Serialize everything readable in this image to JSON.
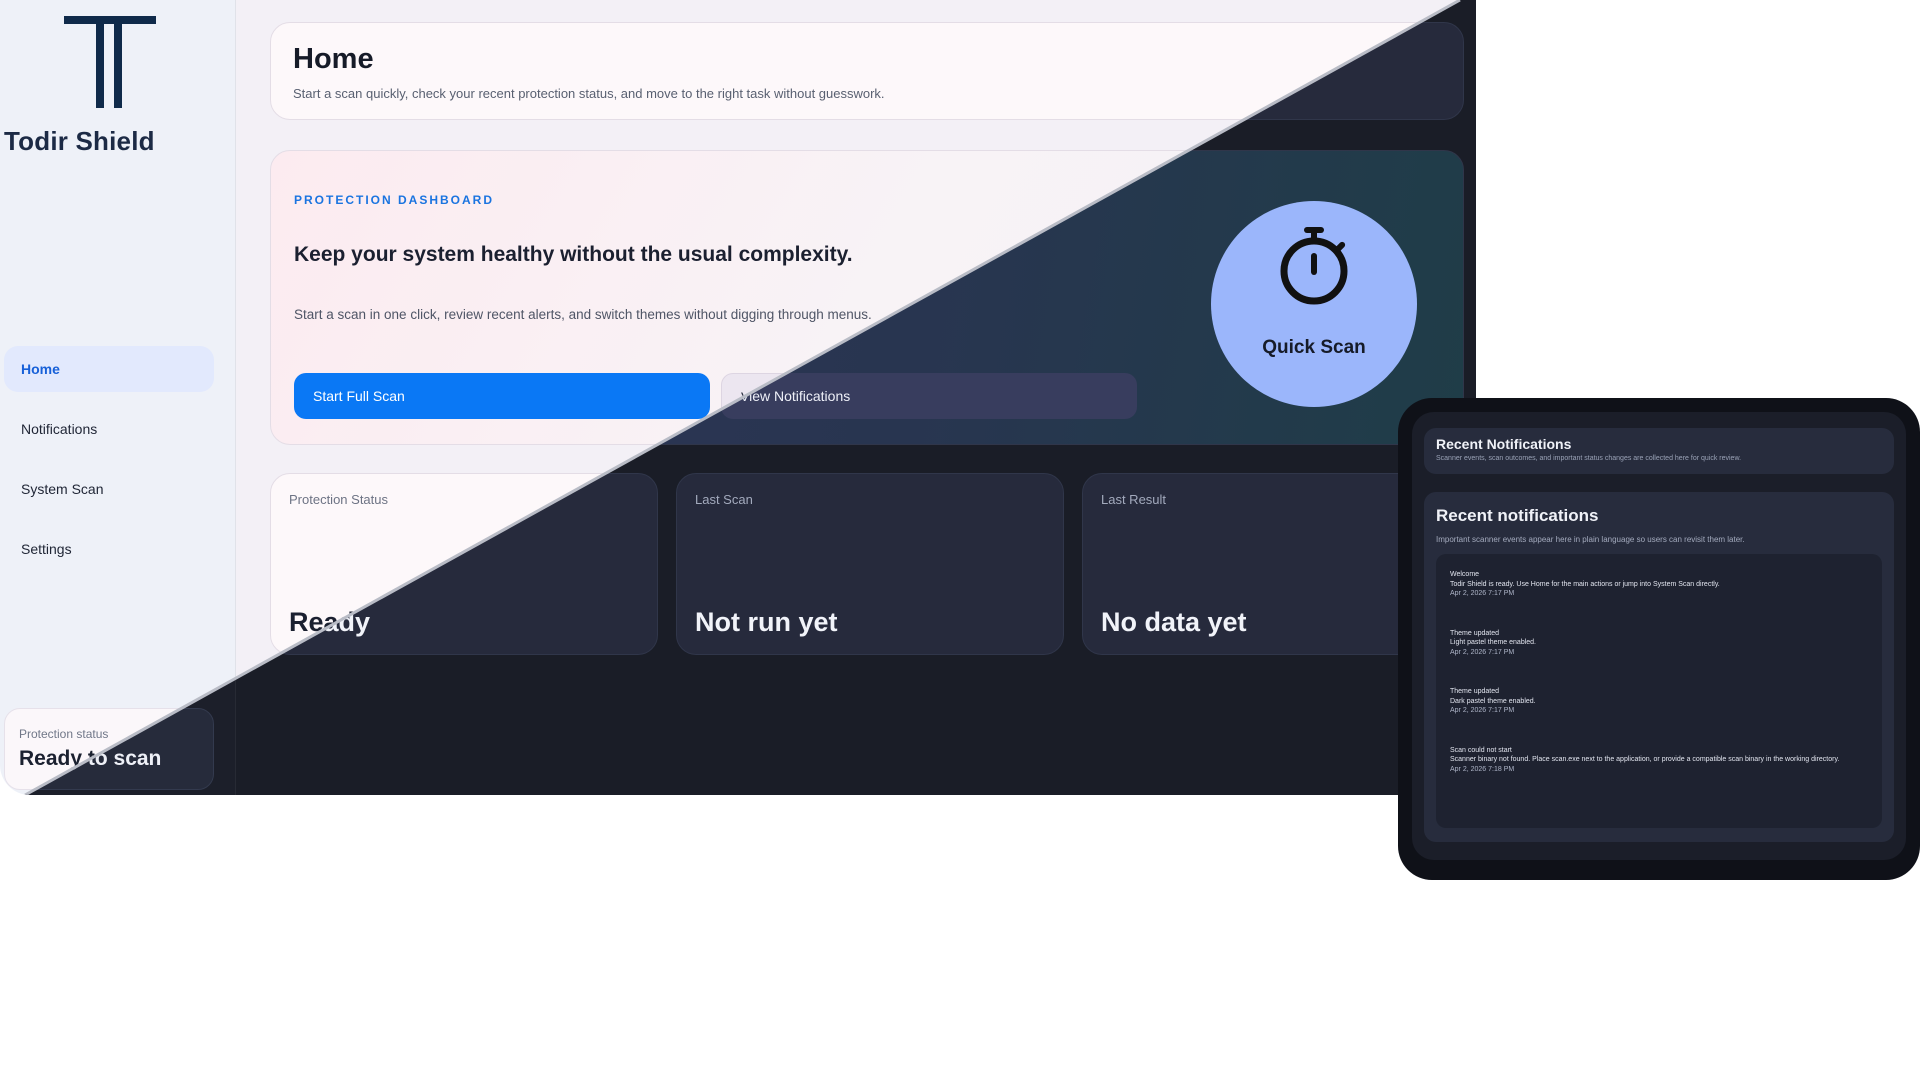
{
  "brand": {
    "name": "Todir Shield",
    "logo_icon": "tower-t-logo-icon"
  },
  "nav": {
    "items": [
      {
        "label": "Home",
        "active": true
      },
      {
        "label": "Notifications",
        "active": false
      },
      {
        "label": "System Scan",
        "active": false
      },
      {
        "label": "Settings",
        "active": false
      }
    ]
  },
  "side_status": {
    "label": "Protection status",
    "value": "Ready to scan"
  },
  "header": {
    "title": "Home",
    "subtitle": "Start a scan quickly, check your recent protection status, and move to the right task without guesswork."
  },
  "hero": {
    "eyebrow": "PROTECTION DASHBOARD",
    "title": "Keep your system healthy without the usual complexity.",
    "text": "Start a scan in one click, review recent alerts, and switch themes without digging through menus.",
    "primary_label": "Start Full Scan",
    "secondary_label": "View Notifications",
    "quick_scan_label": "Quick Scan",
    "quick_scan_icon": "stopwatch-icon"
  },
  "stats": [
    {
      "label": "Protection Status",
      "value": "Ready"
    },
    {
      "label": "Last Scan",
      "value": "Not run yet"
    },
    {
      "label": "Last Result",
      "value": "No data yet"
    }
  ],
  "device": {
    "header_title": "Recent Notifications",
    "header_sub": "Scanner events, scan outcomes, and important status changes are collected here for quick review.",
    "panel_title": "Recent notifications",
    "panel_sub": "Important scanner events appear here in plain language so users can revisit them later.",
    "notifications": [
      {
        "title": "Welcome",
        "body": "Todir Shield is ready. Use Home for the main actions or jump into System Scan directly.",
        "time": "Apr 2, 2026 7:17 PM"
      },
      {
        "title": "Theme updated",
        "body": "Light pastel theme enabled.",
        "time": "Apr 2, 2026 7:17 PM"
      },
      {
        "title": "Theme updated",
        "body": "Dark pastel theme enabled.",
        "time": "Apr 2, 2026 7:17 PM"
      },
      {
        "title": "Scan could not start",
        "body": "Scanner binary not found. Place scan.exe next to the application, or provide a compatible scan binary in the working directory.",
        "time": "Apr 2, 2026 7:18 PM"
      }
    ]
  },
  "colors": {
    "accent": "#0a78f5",
    "quick_scan": "#9bb6fb",
    "brand_dark": "#0f2a4a"
  }
}
